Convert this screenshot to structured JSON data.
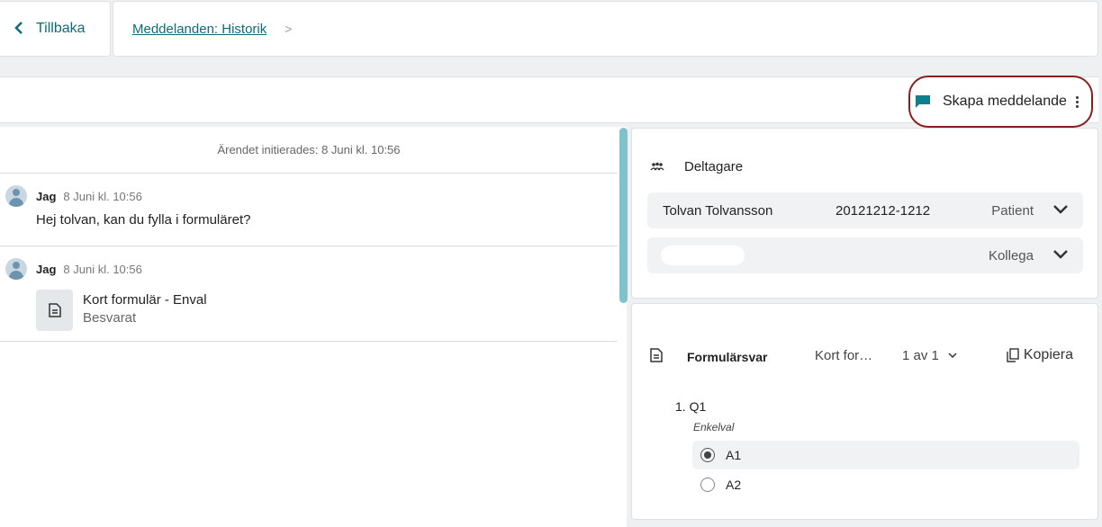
{
  "topbar": {
    "back_label": "Tillbaka",
    "breadcrumb_label": "Meddelanden: Historik",
    "breadcrumb_chevron": ">"
  },
  "toolbar": {
    "create_label": "Skapa meddelande",
    "create_icon": "message-flag-icon",
    "accent_color": "#0e7f8c",
    "highlight_color": "#8b1d1d"
  },
  "conversation": {
    "system_message": "Ärendet initierades: 8 Juni kl. 10:56",
    "messages": [
      {
        "sender": "Jag",
        "time": "8 Juni kl. 10:56",
        "text": "Hej tolvan, kan du fylla i formuläret?"
      },
      {
        "sender": "Jag",
        "time": "8 Juni kl. 10:56",
        "attachment": {
          "title": "Kort formulär - Enval",
          "status": "Besvarat"
        }
      }
    ]
  },
  "participants": {
    "title": "Deltagare",
    "rows": [
      {
        "name": "Tolvan Tolvansson",
        "personal_number": "20121212-1212",
        "role": "Patient"
      },
      {
        "name": "",
        "personal_number": "",
        "role": "Kollega"
      }
    ]
  },
  "form_answers": {
    "title": "Formulärsvar",
    "selected_form": "Kort for…",
    "page_indicator": "1 av 1",
    "copy_label": "Kopiera",
    "question": {
      "number": "1.",
      "text": "Q1",
      "type": "Enkelval",
      "options": [
        {
          "label": "A1",
          "selected": true
        },
        {
          "label": "A2",
          "selected": false
        }
      ]
    }
  }
}
